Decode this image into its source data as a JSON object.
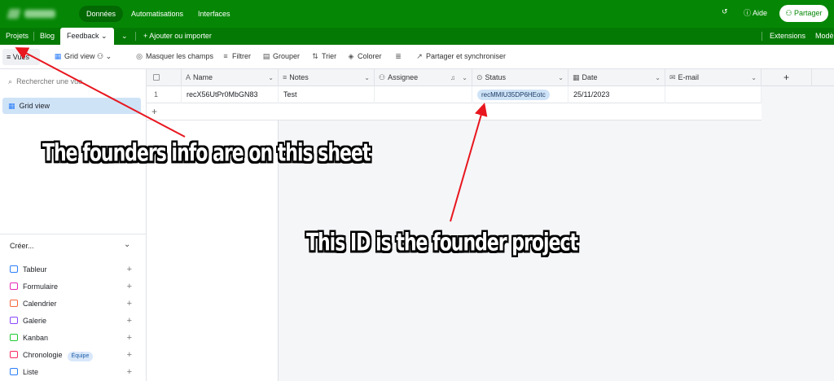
{
  "topbar": {
    "nav_tabs": [
      "Données",
      "Automatisations",
      "Interfaces"
    ],
    "help_label": "Aide",
    "share_label": "Partager",
    "history_icon": "history-icon",
    "help_icon": "question-circle-icon",
    "share_icon": "people-icon"
  },
  "tabbar": {
    "tables": [
      "Projets",
      "Blog",
      "Feedback"
    ],
    "add_label": "Ajouter ou importer",
    "extensions_label": "Extensions",
    "mode_label": "Modè"
  },
  "toolbar": {
    "vues_label": "Vues",
    "view_label": "Grid view",
    "hide_fields_label": "Masquer les champs",
    "filter_label": "Filtrer",
    "group_label": "Grouper",
    "sort_label": "Trier",
    "color_label": "Colorer",
    "share_sync_label": "Partager et synchroniser"
  },
  "sidebar": {
    "search_placeholder": "Rechercher une vue",
    "active_view": "Grid view",
    "create_heading": "Créer...",
    "create_items": [
      {
        "label": "Tableur",
        "color": "#2d7ff9"
      },
      {
        "label": "Formulaire",
        "color": "#e929ba"
      },
      {
        "label": "Calendrier",
        "color": "#f7653b"
      },
      {
        "label": "Galerie",
        "color": "#8b46ff"
      },
      {
        "label": "Kanban",
        "color": "#20c933"
      },
      {
        "label": "Chronologie",
        "color": "#f82b60",
        "badge": "Équipe"
      },
      {
        "label": "Liste",
        "color": "#2d7ff9"
      }
    ]
  },
  "grid": {
    "columns": [
      {
        "label": "Name",
        "icon": "A"
      },
      {
        "label": "Notes",
        "icon": "≡"
      },
      {
        "label": "Assignee",
        "icon": "👤"
      },
      {
        "label": "Status",
        "icon": "⊙"
      },
      {
        "label": "Date",
        "icon": "▦"
      },
      {
        "label": "E-mail",
        "icon": "✉"
      }
    ],
    "rows": [
      {
        "num": "1",
        "name": "recX56UtPr0MbGN83",
        "notes": "Test",
        "assignee": "",
        "status": "recMMIU35DP6HEotc",
        "date": "25/11/2023",
        "email": ""
      }
    ],
    "add_row": "+",
    "add_column": "+"
  },
  "annotations": {
    "sheet_note": "The founders info are on this sheet",
    "id_note": "This ID is the founder project"
  },
  "colors": {
    "brand_green": "#058705",
    "selected_blue": "#cfe3f7",
    "arrow_red": "#e8161e"
  }
}
